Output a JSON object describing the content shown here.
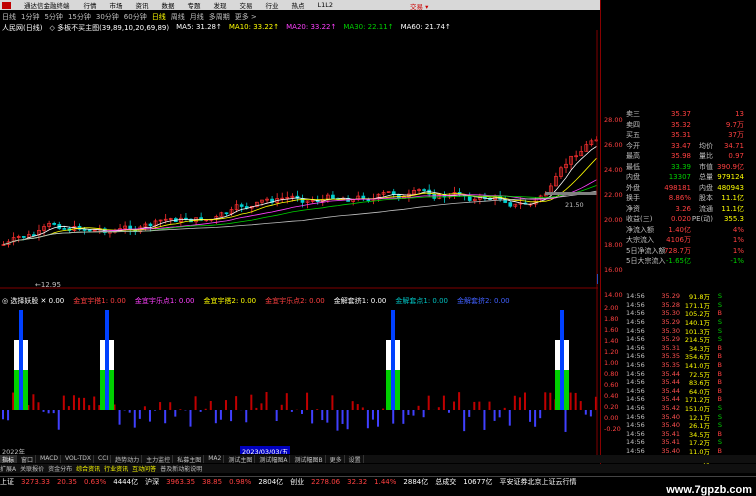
{
  "menu": {
    "items": [
      "行情",
      "市场",
      "资讯",
      "数据",
      "专题",
      "发现",
      "交易",
      "行业",
      "热点",
      "L1L2"
    ],
    "app": "通达信金融终端",
    "trade": "交易 ▾"
  },
  "periods": [
    "日线",
    "1分钟",
    "5分钟",
    "15分钟",
    "30分钟",
    "60分钟",
    "日线",
    "周线",
    "月线",
    "多周期",
    "更多 >"
  ],
  "period_active": 6,
  "infoline": {
    "stock": "人民网(日线)",
    "sub": "◇ 多板不买主图(39,89,10,20,69,89)",
    "ma5": "MA5: 31.28↑",
    "ma10": "MA10: 33.22↑",
    "ma20": "MA20: 33.22↑",
    "ma30": "MA30: 22.11↑",
    "ma60": "MA60: 21.74↑"
  },
  "price_axis": [
    "28.00",
    "26.00",
    "24.00",
    "22.00",
    "20.00",
    "18.00",
    "16.00",
    "14.00"
  ],
  "chart_labels": {
    "hi_label": "←12.95",
    "mid_label": "21.50",
    "low_label": "13.26"
  },
  "ind2line": {
    "name": "◎ 选择妖股 ✕ 0.00",
    "a": "金宜宇搭1: 0.00",
    "b": "金宜宇乐点1: 0.00",
    "c": "金宜宇搭2: 0.00",
    "d": "金宜宇乐点2: 0.00",
    "e": "金解套挤1: 0.00",
    "f": "金解套点1: 0.00",
    "g": "金解套挤2: 0.00"
  },
  "ind_axis": [
    "2.00",
    "1.80",
    "1.60",
    "1.40",
    "1.20",
    "1.00",
    "0.80",
    "0.60",
    "0.40",
    "0.20",
    "0.00",
    "-0.20"
  ],
  "dates": {
    "left": "2022年",
    "highlight": "2023/03/03/五"
  },
  "tabs": [
    "指标",
    "窗口",
    "MACD",
    "VOL-TDX",
    "CCI",
    "趋势动力",
    "主力监控",
    "私募主图",
    "MA2",
    "测试主图",
    "测试幅图A",
    "测试幅图B",
    "更多",
    "设置"
  ],
  "tab_selected": 0,
  "tabs2": [
    "扩展A",
    "关联报价",
    "资金分布",
    "综合资讯",
    "行业资讯",
    "互动问答",
    "普及新动能说明"
  ],
  "quote": [
    {
      "l": "卖三",
      "v1": "35.37",
      "l2": "",
      "v2": "13"
    },
    {
      "l": "卖四",
      "v1": "35.32",
      "l2": "",
      "v2": "9.7万"
    },
    {
      "l": "买五",
      "v1": "35.31",
      "l2": "",
      "v2": "37万"
    },
    {
      "l": "今开",
      "v1": "33.47",
      "l2": "均价",
      "v2": "34.71"
    },
    {
      "l": "最高",
      "v1": "35.98",
      "l2": "量比",
      "v2": "0.97"
    },
    {
      "l": "最低",
      "v1": "33.39",
      "l2": "市值",
      "v2": "390.9亿"
    },
    {
      "l": "内盘",
      "v1": "13307",
      "l2": "总量",
      "v2": "979124"
    },
    {
      "l": "外盘",
      "v1": "498181",
      "l2": "内盘",
      "v2": "480943"
    },
    {
      "l": "换手",
      "v1": "8.86%",
      "l2": "股本",
      "v2": "11.1亿"
    },
    {
      "l": "净资",
      "v1": "3.26",
      "l2": "流通",
      "v2": "11.1亿"
    },
    {
      "l": "收益(三)",
      "v1": "0.020",
      "l2": "PE(动)",
      "v2": "355.3"
    },
    {
      "l": "净流入额",
      "v1": "1.40亿",
      "l2": "",
      "v2": "4%"
    },
    {
      "l": "大宗流入",
      "v1": "4106万",
      "l2": "",
      "v2": "1%"
    },
    {
      "l": "5日净流入额",
      "v1": "728.7万",
      "l2": "",
      "v2": "1%"
    },
    {
      "l": "5日大宗流入",
      "v1": "-1.65亿",
      "l2": "",
      "v2": "-1%"
    }
  ],
  "ticks": [
    {
      "t": "14:56",
      "p": "35.29",
      "vol": "91.8万",
      "bs": "S"
    },
    {
      "t": "14:56",
      "p": "35.28",
      "vol": "171.1万",
      "bs": "S"
    },
    {
      "t": "14:56",
      "p": "35.30",
      "vol": "105.2万",
      "bs": "B"
    },
    {
      "t": "14:56",
      "p": "35.29",
      "vol": "140.1万",
      "bs": "S"
    },
    {
      "t": "14:56",
      "p": "35.30",
      "vol": "101.3万",
      "bs": "S"
    },
    {
      "t": "14:56",
      "p": "35.29",
      "vol": "214.5万",
      "bs": "S"
    },
    {
      "t": "14:56",
      "p": "35.31",
      "vol": "34.3万",
      "bs": "B"
    },
    {
      "t": "14:56",
      "p": "35.35",
      "vol": "354.6万",
      "bs": "B"
    },
    {
      "t": "14:56",
      "p": "35.35",
      "vol": "141.0万",
      "bs": "B"
    },
    {
      "t": "14:56",
      "p": "35.44",
      "vol": "72.5万",
      "bs": "B"
    },
    {
      "t": "14:56",
      "p": "35.44",
      "vol": "83.6万",
      "bs": "B"
    },
    {
      "t": "14:56",
      "p": "35.44",
      "vol": "64.0万",
      "bs": "B"
    },
    {
      "t": "14:56",
      "p": "35.44",
      "vol": "171.2万",
      "bs": "B"
    },
    {
      "t": "14:56",
      "p": "35.42",
      "vol": "151.0万",
      "bs": "S"
    },
    {
      "t": "14:56",
      "p": "35.40",
      "vol": "12.1万",
      "bs": "S"
    },
    {
      "t": "14:56",
      "p": "35.40",
      "vol": "26.1万",
      "bs": "S"
    },
    {
      "t": "14:56",
      "p": "35.41",
      "vol": "34.5万",
      "bs": "B"
    },
    {
      "t": "14:56",
      "p": "35.41",
      "vol": "17.2万",
      "bs": "S"
    },
    {
      "t": "14:56",
      "p": "35.40",
      "vol": "11.0万",
      "bs": "B"
    },
    {
      "t": "14:56",
      "p": "35.40",
      "vol": "13.1万",
      "bs": "B"
    }
  ],
  "status": [
    {
      "name": "上证",
      "val": "3273.33",
      "chg": "20.35",
      "pct": "0.63%",
      "amt": "4444亿"
    },
    {
      "name": "沪深",
      "val": "3963.35",
      "chg": "38.85",
      "pct": "0.98%",
      "amt": "2804亿"
    },
    {
      "name": "创业",
      "val": "2278.06",
      "chg": "32.32",
      "pct": "1.44%",
      "amt": "2884亿"
    }
  ],
  "status_extra": {
    "label": "总成交",
    "val": "10677亿",
    "note": "平安证券北京上证云行情"
  },
  "watermark": "www.7gpzb.com"
}
